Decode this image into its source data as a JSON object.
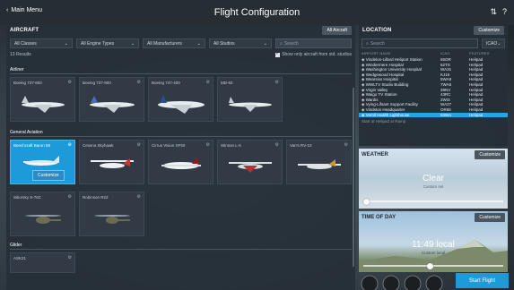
{
  "window": {
    "back_label": "Main Menu",
    "title": "Flight Configuration"
  },
  "aircraft": {
    "header": "AIRCRAFT",
    "button": "All Aircraft",
    "filters": [
      "All Classes",
      "All Engine Types",
      "All Manufacturers",
      "All Studios"
    ],
    "search_placeholder": "Search",
    "results": "13 Results",
    "show_toggle": "Show only aircraft from std. studios",
    "categories": [
      {
        "name": "Airliner",
        "items": [
          "Boeing 737-800",
          "Boeing 737-900",
          "Boeing 747-400",
          "MD-82"
        ]
      },
      {
        "name": "General Aviation",
        "items": [
          "Beechcraft Baron 58",
          "Cessna Skyhawk",
          "Cirrus Vision SF50",
          "Stinson L-5",
          "Van's RV-10"
        ]
      },
      {
        "name": "",
        "items": [
          "Sikorsky S-76C",
          "Robinson R22"
        ]
      },
      {
        "name": "Glider",
        "items": [
          "ASK21"
        ]
      }
    ],
    "customize_label": "Customize"
  },
  "location": {
    "header": "LOCATION",
    "customize": "Customize",
    "search_placeholder": "Search",
    "code": "ICAO",
    "columns": [
      "AIRPORT NAME",
      "ICAO",
      "FEATURES"
    ],
    "rows": [
      {
        "name": "Vindelon-Lillard Heliport Station",
        "icao": "56OR",
        "feat": "Helipad"
      },
      {
        "name": "Windermere Hospital",
        "icao": "62TS",
        "feat": "Helipad"
      },
      {
        "name": "Washington University Hospital",
        "icao": "WA31",
        "feat": "Helipad"
      },
      {
        "name": "Wedgewood Hospital",
        "icao": "KJ16",
        "feat": "Helipad"
      },
      {
        "name": "Wearsiss Hospital",
        "icao": "5WA9",
        "feat": "Helipad"
      },
      {
        "name": "WWLTV Studio Building",
        "icao": "7WA6",
        "feat": "Helipad"
      },
      {
        "name": "Virgin Valley",
        "icao": "39NV",
        "feat": "Helipad"
      },
      {
        "name": "Waigo TV Station",
        "icao": "43RC",
        "feat": "Helipad"
      },
      {
        "name": "Wardis",
        "icao": "2WI3",
        "feat": "Helipad"
      },
      {
        "name": "Vying-Lifsant Support Facility",
        "icao": "WA27",
        "feat": "Helipad"
      },
      {
        "name": "Vindston Headquarter",
        "icao": "OR65",
        "feat": "Helipad"
      },
      {
        "name": "Vernil Health Lighthouse",
        "icao": "53WA",
        "feat": "Helipad"
      }
    ],
    "active_row": 11,
    "footer": "Start at Helipad at Ramp"
  },
  "weather": {
    "header": "WEATHER",
    "customize": "Customize",
    "value": "Clear",
    "sub": "Custom set",
    "slider_level": 0.02
  },
  "time_of_day": {
    "header": "TIME OF DAY",
    "customize": "Customize",
    "value": "11:49 local",
    "sub": "Custom local",
    "slider_level": 0.48
  },
  "start_button": "Start Flight",
  "colors": {
    "accent": "#1e9ad9",
    "panel": "#262f38",
    "topbar": "#262d33"
  },
  "icons": [
    "chevron-left-icon",
    "settings-icon",
    "help-icon",
    "gear-icon",
    "chevron-down-icon",
    "search-icon",
    "helicopter-icon"
  ]
}
